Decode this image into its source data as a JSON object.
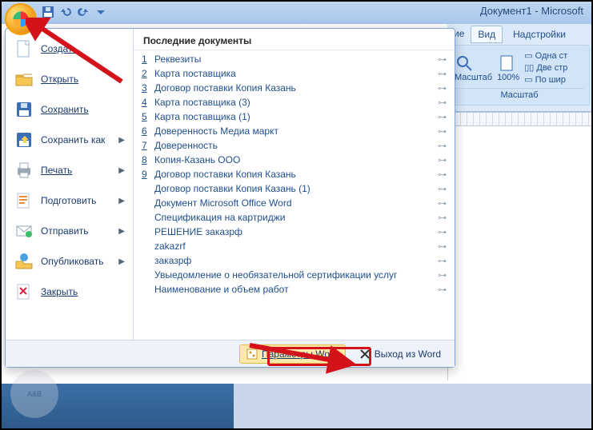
{
  "window": {
    "title": "Документ1 - Microsoft"
  },
  "ribbon": {
    "tabs": {
      "view": "Вид",
      "addins": "Надстройки"
    },
    "zoom_group": "Масштаб",
    "zoom_btn": "Масштаб",
    "zoom_val": "100%",
    "opt1": "Одна ст",
    "opt2": "Две стр",
    "opt3": "По шир"
  },
  "menu": {
    "left": {
      "new": {
        "label": "Создать"
      },
      "open": {
        "label": "Открыть"
      },
      "save": {
        "label": "Сохранить"
      },
      "saveas": {
        "label": "Сохранить как"
      },
      "print": {
        "label": "Печать"
      },
      "prep": {
        "label": "Подготовить"
      },
      "send": {
        "label": "Отправить"
      },
      "pub": {
        "label": "Опубликовать"
      },
      "close": {
        "label": "Закрыть"
      }
    },
    "recent_header": "Последние документы",
    "recent": [
      {
        "n": "1",
        "name": "Реквезиты"
      },
      {
        "n": "2",
        "name": "Карта поставщика"
      },
      {
        "n": "3",
        "name": "Договор поставки Копия Казань"
      },
      {
        "n": "4",
        "name": "Карта поставщика (3)"
      },
      {
        "n": "5",
        "name": "Карта поставщика (1)"
      },
      {
        "n": "6",
        "name": "Доверенность Медиа маркт"
      },
      {
        "n": "7",
        "name": "Доверенность"
      },
      {
        "n": "8",
        "name": "Копия-Казань ООО"
      },
      {
        "n": "9",
        "name": "Договор поставки Копия Казань"
      },
      {
        "n": "",
        "name": "Договор поставки Копия Казань (1)"
      },
      {
        "n": "",
        "name": "Документ Microsoft Office Word"
      },
      {
        "n": "",
        "name": "Спецификация на картриджи"
      },
      {
        "n": "",
        "name": "РЕШЕНИЕ   заказрф"
      },
      {
        "n": "",
        "name": "zakazrf"
      },
      {
        "n": "",
        "name": "заказрф"
      },
      {
        "n": "",
        "name": "Увыедомление о необязательной сертификации услуг"
      },
      {
        "n": "",
        "name": "Наименование и объем работ"
      }
    ],
    "footer": {
      "options": "Параметры Word",
      "exit": "Выход из Word"
    }
  }
}
